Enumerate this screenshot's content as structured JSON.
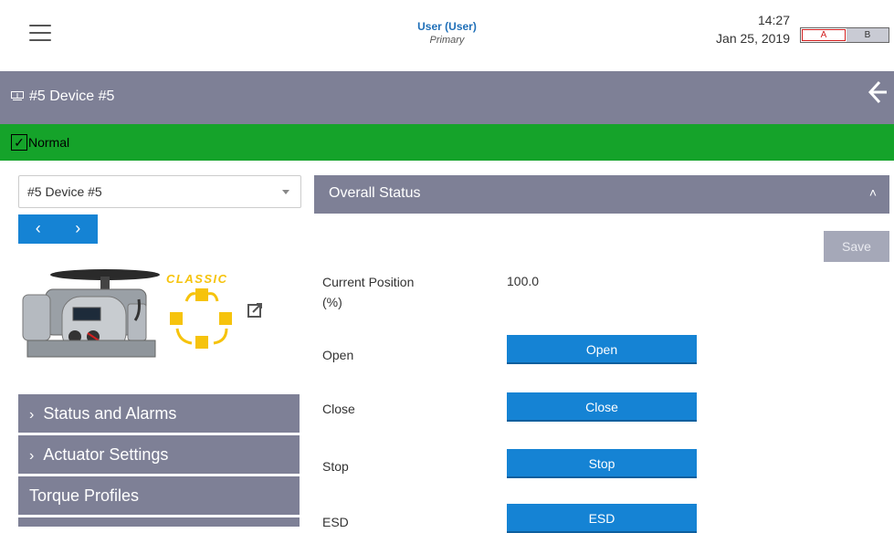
{
  "header": {
    "user_name": "User (User)",
    "user_role": "Primary",
    "time": "14:27",
    "date": "Jan 25, 2019",
    "toggle_a": "A",
    "toggle_b": "B"
  },
  "titlebar": {
    "title": "#5 Device #5"
  },
  "status": {
    "label": "Normal",
    "color": "#15a32a"
  },
  "sidebar": {
    "device_select_value": "#5 Device #5",
    "prev_label": "‹",
    "next_label": "›",
    "logo_text": "CLASSIC",
    "menu": [
      {
        "label": "Status and Alarms",
        "expandable": true
      },
      {
        "label": "Actuator Settings",
        "expandable": true
      },
      {
        "label": "Torque Profiles",
        "expandable": false
      }
    ]
  },
  "panel": {
    "title": "Overall Status",
    "save_label": "Save",
    "current_position_label": "Current Position\n(%)",
    "current_position_value": "100.0",
    "rows": [
      {
        "label": "Open",
        "button": "Open"
      },
      {
        "label": "Close",
        "button": "Close"
      },
      {
        "label": "Stop",
        "button": "Stop"
      },
      {
        "label": "ESD",
        "button": "ESD"
      }
    ]
  },
  "colors": {
    "accent": "#1583d4",
    "bar": "#7e8096",
    "logo": "#f6c30c"
  }
}
